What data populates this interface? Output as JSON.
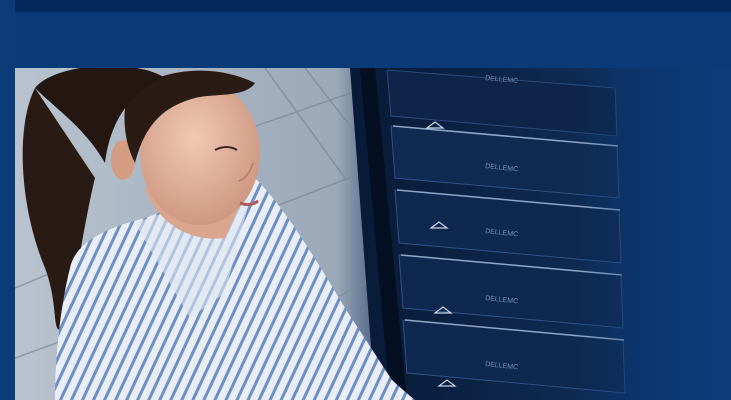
{
  "hero": {
    "server_brand_text": "DELLEMC",
    "photo_description": ""
  },
  "colors": {
    "page_background": "#0b3b78",
    "top_strip": "#05295a",
    "banner_band": "#0a3a78",
    "rack_dark": "#07162f",
    "rack_panel": "#0f2b54",
    "accent_blue": "#1f5fb0"
  }
}
